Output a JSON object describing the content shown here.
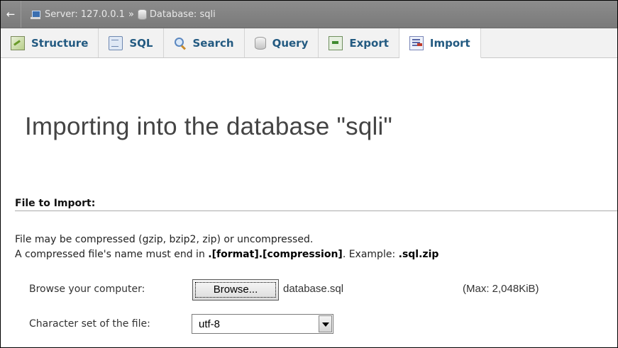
{
  "breadcrumb": {
    "back_glyph": "←",
    "server_label": "Server: 127.0.0.1",
    "separator": "»",
    "database_label": "Database: sqli"
  },
  "tabs": [
    {
      "label": "Structure",
      "icon": "structure-icon",
      "active": false
    },
    {
      "label": "SQL",
      "icon": "sql-icon",
      "active": false
    },
    {
      "label": "Search",
      "icon": "search-icon",
      "active": false
    },
    {
      "label": "Query",
      "icon": "query-icon",
      "active": false
    },
    {
      "label": "Export",
      "icon": "export-icon",
      "active": false
    },
    {
      "label": "Import",
      "icon": "import-icon",
      "active": true
    }
  ],
  "page_title": "Importing into the database \"sqli\"",
  "file_section": {
    "heading": "File to Import:",
    "line1": "File may be compressed (gzip, bzip2, zip) or uncompressed.",
    "line2_prefix": "A compressed file's name must end in ",
    "line2_format": ".[format].[compression]",
    "line2_middle": ". Example: ",
    "line2_example": ".sql.zip",
    "browse_label": "Browse your computer:",
    "browse_button": "Browse...",
    "selected_file": "database.sql",
    "max_size": "(Max: 2,048KiB)",
    "charset_label": "Character set of the file:",
    "charset_value": "utf-8"
  },
  "colors": {
    "tab_text": "#235a81",
    "breadcrumb_bg": "#868686",
    "title_text": "#444444"
  }
}
